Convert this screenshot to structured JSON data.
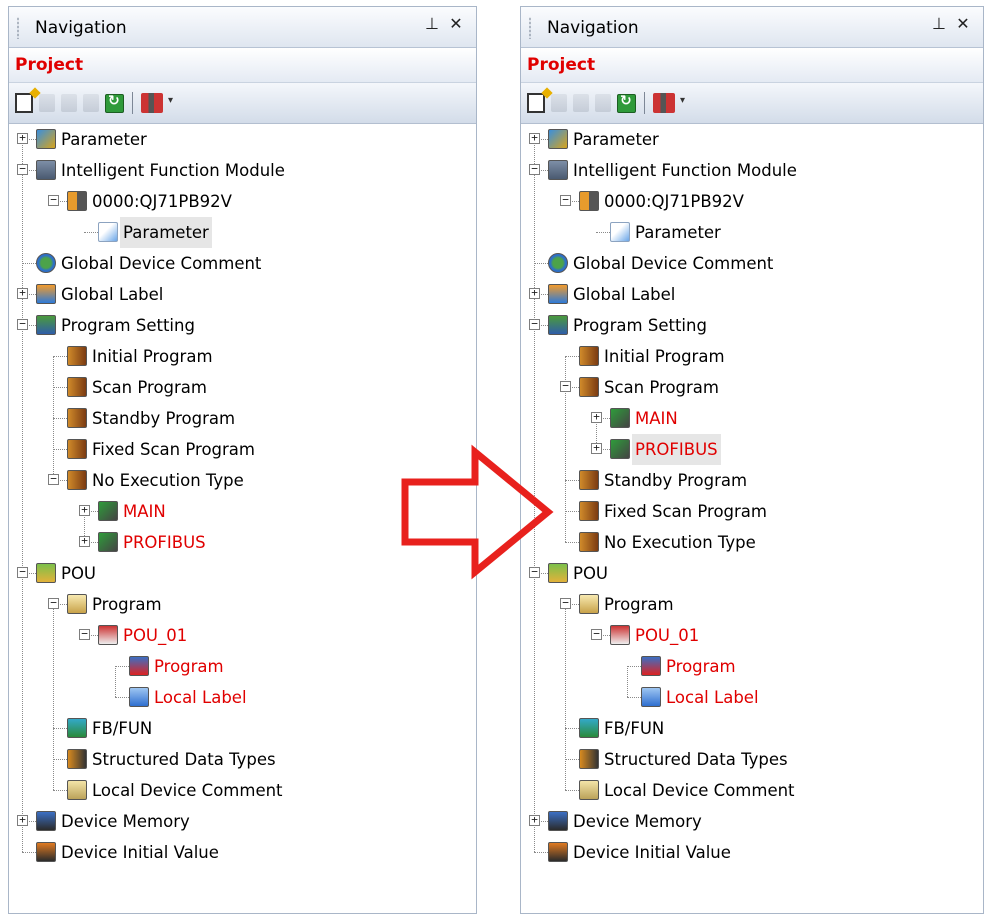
{
  "colors": {
    "project_label": "#e00000",
    "red_item": "#e00000",
    "arrow": "#e8211d"
  },
  "left_panel": {
    "title": "Navigation",
    "pin_glyph": "⊥",
    "close_glyph": "✕",
    "project_label": "Project",
    "toolbar_icons": [
      "new-item-icon",
      "copy-icon",
      "paste-icon",
      "properties-icon",
      "refresh-icon",
      "tool-dropdown-icon"
    ],
    "items": [
      {
        "label": "Parameter",
        "icon": "parameter-icon",
        "red": false
      },
      {
        "label": "Intelligent Function Module",
        "icon": "module-icon",
        "red": false
      },
      {
        "label": "0000:QJ71PB92V",
        "icon": "module-unit-icon",
        "red": false
      },
      {
        "label": "Parameter",
        "icon": "parameter-file-icon",
        "red": false,
        "selected": true
      },
      {
        "label": "Global Device Comment",
        "icon": "global-comment-icon",
        "red": false
      },
      {
        "label": "Global Label",
        "icon": "global-label-icon",
        "red": false
      },
      {
        "label": "Program Setting",
        "icon": "program-setting-icon",
        "red": false
      },
      {
        "label": "Initial Program",
        "icon": "program-type-icon",
        "red": false
      },
      {
        "label": "Scan Program",
        "icon": "program-type-icon",
        "red": false
      },
      {
        "label": "Standby Program",
        "icon": "program-type-icon",
        "red": false
      },
      {
        "label": "Fixed Scan Program",
        "icon": "program-type-icon",
        "red": false
      },
      {
        "label": "No Execution Type",
        "icon": "program-type-icon",
        "red": false
      },
      {
        "label": "MAIN",
        "icon": "program-file-icon",
        "red": true
      },
      {
        "label": "PROFIBUS",
        "icon": "program-file-icon",
        "red": true
      },
      {
        "label": "POU",
        "icon": "pou-icon",
        "red": false
      },
      {
        "label": "Program",
        "icon": "folder-icon",
        "red": false
      },
      {
        "label": "POU_01",
        "icon": "pou-item-icon",
        "red": true
      },
      {
        "label": "Program",
        "icon": "program-body-icon",
        "red": true
      },
      {
        "label": "Local Label",
        "icon": "local-label-icon",
        "red": true
      },
      {
        "label": "FB/FUN",
        "icon": "fb-fun-icon",
        "red": false
      },
      {
        "label": "Structured Data Types",
        "icon": "struct-icon",
        "red": false
      },
      {
        "label": "Local Device Comment",
        "icon": "local-comment-icon",
        "red": false
      },
      {
        "label": "Device Memory",
        "icon": "device-memory-icon",
        "red": false
      },
      {
        "label": "Device Initial Value",
        "icon": "device-initial-icon",
        "red": false
      }
    ]
  },
  "right_panel": {
    "title": "Navigation",
    "pin_glyph": "⊥",
    "close_glyph": "✕",
    "project_label": "Project",
    "toolbar_icons": [
      "new-item-icon",
      "copy-icon",
      "paste-icon",
      "properties-icon",
      "refresh-icon",
      "tool-dropdown-icon"
    ],
    "items": [
      {
        "label": "Parameter",
        "icon": "parameter-icon",
        "red": false
      },
      {
        "label": "Intelligent Function Module",
        "icon": "module-icon",
        "red": false
      },
      {
        "label": "0000:QJ71PB92V",
        "icon": "module-unit-icon",
        "red": false
      },
      {
        "label": "Parameter",
        "icon": "parameter-file-icon",
        "red": false
      },
      {
        "label": "Global Device Comment",
        "icon": "global-comment-icon",
        "red": false
      },
      {
        "label": "Global Label",
        "icon": "global-label-icon",
        "red": false
      },
      {
        "label": "Program Setting",
        "icon": "program-setting-icon",
        "red": false
      },
      {
        "label": "Initial Program",
        "icon": "program-type-icon",
        "red": false
      },
      {
        "label": "Scan Program",
        "icon": "program-type-icon",
        "red": false
      },
      {
        "label": "MAIN",
        "icon": "program-file-icon",
        "red": true
      },
      {
        "label": "PROFIBUS",
        "icon": "program-file-icon",
        "red": true,
        "selected": true
      },
      {
        "label": "Standby Program",
        "icon": "program-type-icon",
        "red": false
      },
      {
        "label": "Fixed Scan Program",
        "icon": "program-type-icon",
        "red": false
      },
      {
        "label": "No Execution Type",
        "icon": "program-type-icon",
        "red": false
      },
      {
        "label": "POU",
        "icon": "pou-icon",
        "red": false
      },
      {
        "label": "Program",
        "icon": "folder-icon",
        "red": false
      },
      {
        "label": "POU_01",
        "icon": "pou-item-icon",
        "red": true
      },
      {
        "label": "Program",
        "icon": "program-body-icon",
        "red": true
      },
      {
        "label": "Local Label",
        "icon": "local-label-icon",
        "red": true
      },
      {
        "label": "FB/FUN",
        "icon": "fb-fun-icon",
        "red": false
      },
      {
        "label": "Structured Data Types",
        "icon": "struct-icon",
        "red": false
      },
      {
        "label": "Local Device Comment",
        "icon": "local-comment-icon",
        "red": false
      },
      {
        "label": "Device Memory",
        "icon": "device-memory-icon",
        "red": false
      },
      {
        "label": "Device Initial Value",
        "icon": "device-initial-icon",
        "red": false
      }
    ]
  }
}
